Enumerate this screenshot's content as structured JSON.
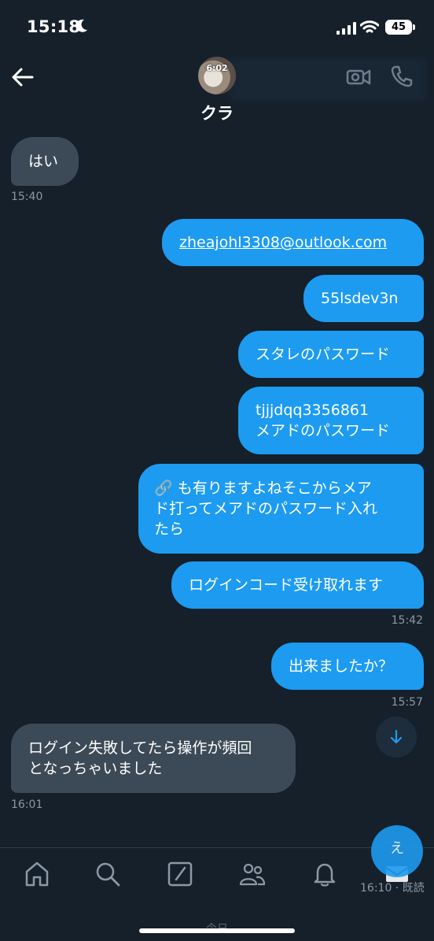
{
  "status": {
    "time": "15:18",
    "battery": "45"
  },
  "header": {
    "contact_name": "クラ",
    "avatar_overlay": "6:02"
  },
  "messages": [
    {
      "text": "はい",
      "timestamp": "15:40"
    },
    {
      "text": "zheajohl3308@outlook.com"
    },
    {
      "text": "55lsdev3n"
    },
    {
      "text": "スタレのパスワード"
    },
    {
      "line1": "tjjjdqq3356861",
      "line2": "メアドのパスワード"
    },
    {
      "line1": "🔗 も有りますよねそこからメア",
      "line2": "ド打ってメアドのパスワード入れ",
      "line3": "たら"
    },
    {
      "text": "ログインコード受け取れます",
      "timestamp": "15:42"
    },
    {
      "text": "出来ましたか？",
      "timestamp": "15:57"
    },
    {
      "line1": "ログイン失敗してたら操作が頻回",
      "line2": "となっちゃいました",
      "timestamp": "16:01"
    }
  ],
  "compose_fab": {
    "label": "え"
  },
  "footer": {
    "timestamp": "16:10",
    "read_label": "既読",
    "today_label": "今日"
  },
  "icons": {
    "back": "arrow-left-icon",
    "video": "video-camera-icon",
    "phone": "phone-icon",
    "scroll_down": "arrow-down-icon",
    "nav": [
      "home-icon",
      "search-icon",
      "compose-icon",
      "communities-icon",
      "bell-icon",
      "mail-icon"
    ]
  },
  "colors": {
    "background": "#15202b",
    "sent_bubble": "#1d9bf0",
    "received_bubble": "#3c4a57",
    "timestamp": "#8b98a5"
  }
}
